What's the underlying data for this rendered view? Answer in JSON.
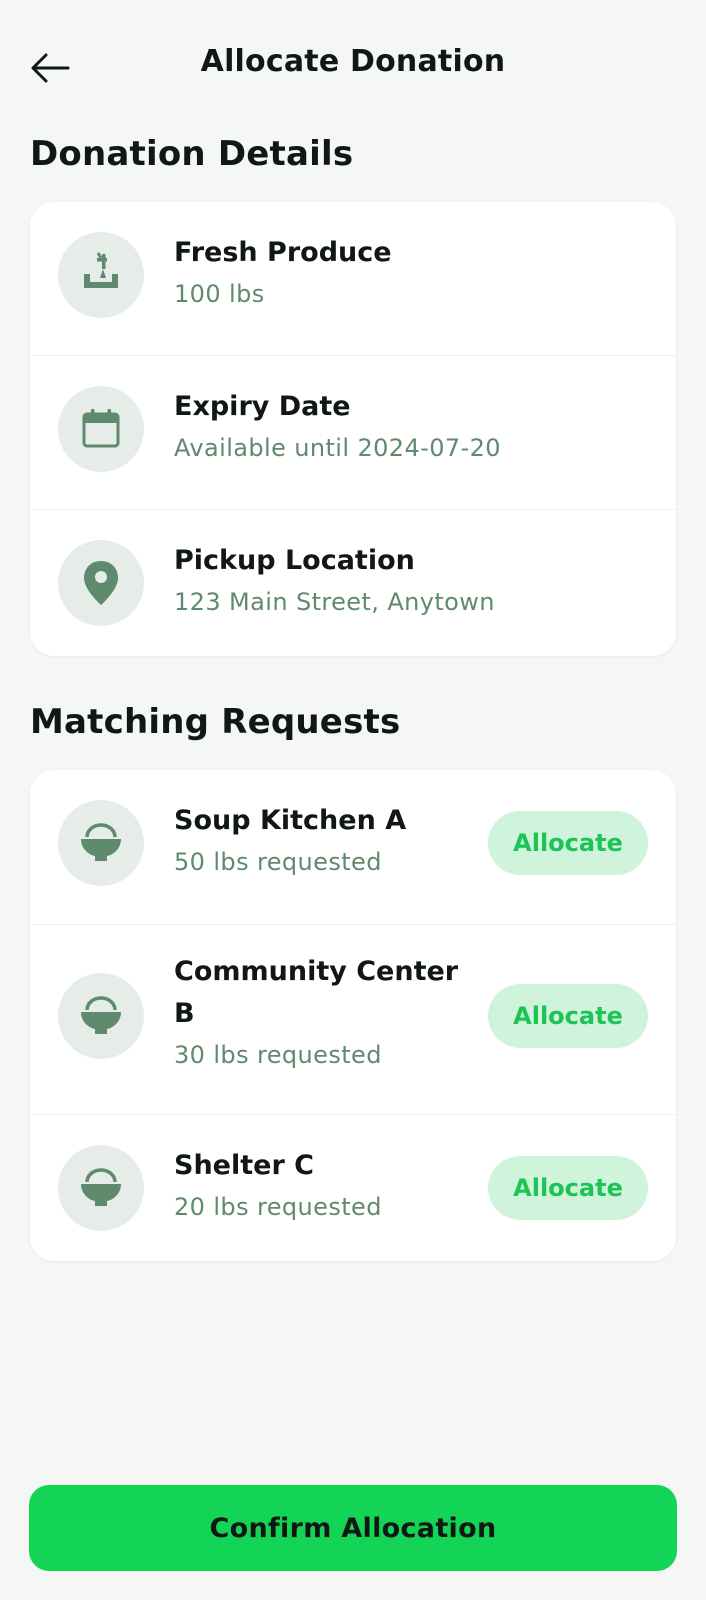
{
  "header": {
    "title": "Allocate Donation",
    "back_icon": "arrow-left-icon"
  },
  "donation_details": {
    "section_title": "Donation Details",
    "items": [
      {
        "icon": "produce-icon",
        "title": "Fresh Produce",
        "subtitle": "100 lbs"
      },
      {
        "icon": "calendar-icon",
        "title": "Expiry Date",
        "subtitle": "Available until 2024-07-20"
      },
      {
        "icon": "location-pin-icon",
        "title": "Pickup Location",
        "subtitle": "123 Main Street, Anytown"
      }
    ]
  },
  "matching_requests": {
    "section_title": "Matching Requests",
    "items": [
      {
        "icon": "bowl-icon",
        "title": "Soup Kitchen A",
        "subtitle": "50 lbs requested",
        "action_label": "Allocate"
      },
      {
        "icon": "bowl-icon",
        "title": "Community Center B",
        "subtitle": "30 lbs requested",
        "action_label": "Allocate"
      },
      {
        "icon": "bowl-icon",
        "title": "Shelter C",
        "subtitle": "20 lbs requested",
        "action_label": "Allocate"
      }
    ]
  },
  "footer": {
    "confirm_label": "Confirm Allocation"
  },
  "colors": {
    "background": "#f5f7f5",
    "accent": "#14d456",
    "accent_soft": "#cff3db",
    "accent_text": "#1bc455",
    "icon": "#5f8a6e",
    "icon_bg": "#e6ede8"
  }
}
